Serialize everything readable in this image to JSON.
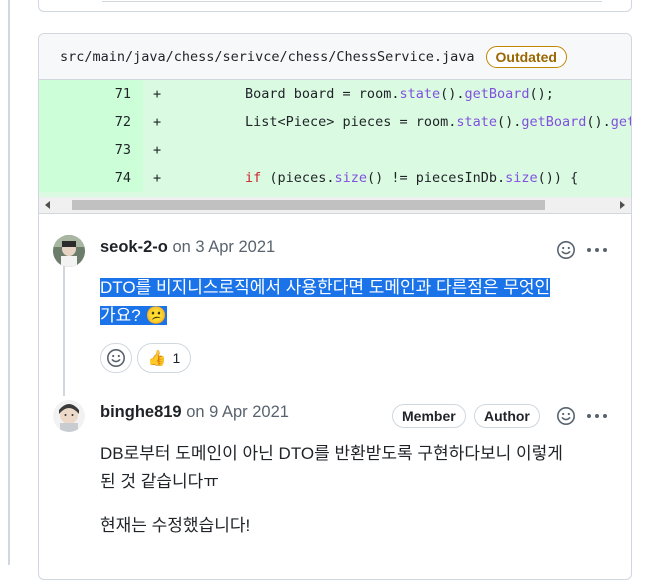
{
  "file": {
    "path": "src/main/java/chess/serivce/chess/ChessService.java",
    "status_badge": "Outdated"
  },
  "diff": {
    "lines": [
      {
        "number": "71",
        "sign": "+",
        "code": "        Board board = room.state().getBoard();"
      },
      {
        "number": "72",
        "sign": "+",
        "code": "        List<Piece> pieces = room.state().getBoard().get"
      },
      {
        "number": "73",
        "sign": "+",
        "code": ""
      },
      {
        "number": "74",
        "sign": "+",
        "code": "        if (pieces.size() != piecesInDb.size()) {"
      }
    ]
  },
  "comments": [
    {
      "author": "seok-2-o",
      "date": "on 3 Apr 2021",
      "body_line1": "DTO를 비지니스로직에서 사용한다면 도메인과 다른점은 무엇인",
      "body_line2": "가요? 😕",
      "reactions": [
        {
          "emoji": "👍",
          "count": "1"
        }
      ]
    },
    {
      "author": "binghe819",
      "date": "on 9 Apr 2021",
      "badges": [
        "Member",
        "Author"
      ],
      "body_line1": "DB로부터 도메인이 아닌 DTO를 반환받도록 구현하다보니 이렇게",
      "body_line2": "된 것 같습니다ㅠ",
      "body_para2": "현재는 수정했습니다!"
    }
  ],
  "icons": {
    "smiley": "smiley-icon",
    "more": "kebab-horizontal-icon",
    "add_reaction": "add-reaction-icon"
  },
  "colors": {
    "diff_bg": "#dafbe1",
    "diff_num_bg": "#ccffd8",
    "outdated": "#9a6700",
    "selection": "#1a73e8"
  }
}
